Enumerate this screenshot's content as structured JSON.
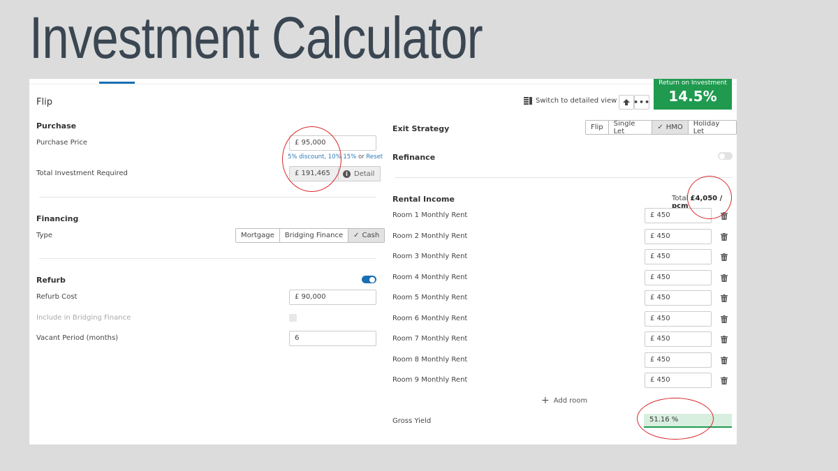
{
  "slide_title": "Investment Calculator",
  "header": {
    "strategy": "Flip",
    "switch_view": "Switch to detailed view",
    "roi_label": "Return on Investment",
    "roi_value": "14.5%",
    "accent_color": "#1f9a4f"
  },
  "purchase": {
    "section": "Purchase",
    "price_label": "Purchase Price",
    "price_value": "£ 95,000",
    "discount_5": "5% discount,",
    "discount_10": "10%",
    "discount_15": "15%",
    "or": "or",
    "reset": "Reset",
    "total_label": "Total Investment Required",
    "total_value": "£ 191,465",
    "detail": "Detail"
  },
  "financing": {
    "section": "Financing",
    "type_label": "Type",
    "options": [
      "Mortgage",
      "Bridging Finance",
      "Cash"
    ],
    "selected": "Cash"
  },
  "refurb": {
    "section": "Refurb",
    "cost_label": "Refurb Cost",
    "cost_value": "£ 90,000",
    "bridging_label": "Include in Bridging Finance",
    "vacant_label": "Vacant Period (months)",
    "vacant_value": "6",
    "enabled": true
  },
  "exit": {
    "section": "Exit Strategy",
    "options": [
      "Flip",
      "Single Let",
      "HMO",
      "Holiday Let"
    ],
    "selected": "HMO"
  },
  "refinance": {
    "section": "Refinance",
    "enabled": false
  },
  "rental": {
    "section": "Rental Income",
    "total_prefix": "Total",
    "total_value": "£4,050 / pcm",
    "rooms": [
      {
        "label": "Room 1 Monthly Rent",
        "value": "£ 450"
      },
      {
        "label": "Room 2 Monthly Rent",
        "value": "£ 450"
      },
      {
        "label": "Room 3 Monthly Rent",
        "value": "£ 450"
      },
      {
        "label": "Room 4 Monthly Rent",
        "value": "£ 450"
      },
      {
        "label": "Room 5 Monthly Rent",
        "value": "£ 450"
      },
      {
        "label": "Room 6 Monthly Rent",
        "value": "£ 450"
      },
      {
        "label": "Room 7 Monthly Rent",
        "value": "£ 450"
      },
      {
        "label": "Room 8 Monthly Rent",
        "value": "£ 450"
      },
      {
        "label": "Room 9 Monthly Rent",
        "value": "£ 450"
      }
    ],
    "add_room": "Add room",
    "gross_yield_label": "Gross Yield",
    "gross_yield_value": "51.16 %"
  }
}
